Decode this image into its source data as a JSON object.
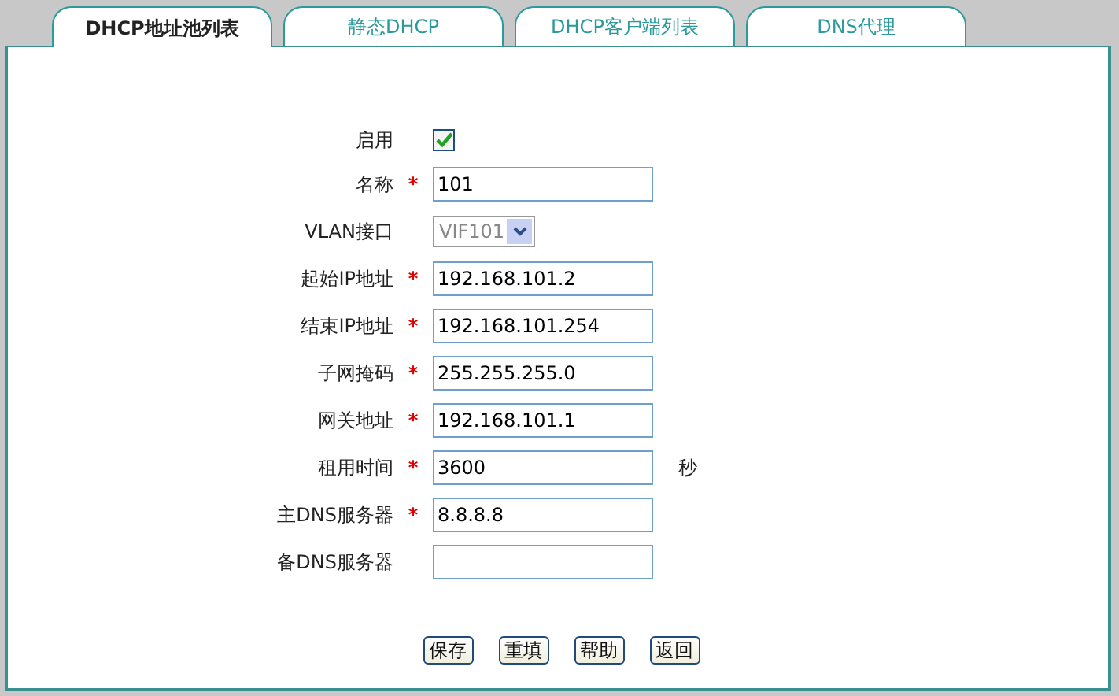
{
  "tabs": [
    {
      "label": "DHCP地址池列表",
      "selected": true
    },
    {
      "label": "静态DHCP",
      "selected": false
    },
    {
      "label": "DHCP客户端列表",
      "selected": false
    },
    {
      "label": "DNS代理",
      "selected": false
    }
  ],
  "form": [
    {
      "kind": "checkbox",
      "label": "启用",
      "required": false,
      "checked": true
    },
    {
      "kind": "text",
      "label": "名称",
      "required": true,
      "value": "101"
    },
    {
      "kind": "select",
      "label": "VLAN接口",
      "required": false,
      "value": "VIF101",
      "disabled": true
    },
    {
      "kind": "text",
      "label": "起始IP地址",
      "required": true,
      "value": "192.168.101.2"
    },
    {
      "kind": "text",
      "label": "结束IP地址",
      "required": true,
      "value": "192.168.101.254"
    },
    {
      "kind": "text",
      "label": "子网掩码",
      "required": true,
      "value": "255.255.255.0"
    },
    {
      "kind": "text",
      "label": "网关地址",
      "required": true,
      "value": "192.168.101.1"
    },
    {
      "kind": "text",
      "label": "租用时间",
      "required": true,
      "value": "3600",
      "suffix": "秒"
    },
    {
      "kind": "text",
      "label": "主DNS服务器",
      "required": true,
      "value": "8.8.8.8"
    },
    {
      "kind": "text",
      "label": "备DNS服务器",
      "required": false
    }
  ],
  "required_mark": "*",
  "buttons": [
    "保存",
    "重填",
    "帮助",
    "返回"
  ]
}
